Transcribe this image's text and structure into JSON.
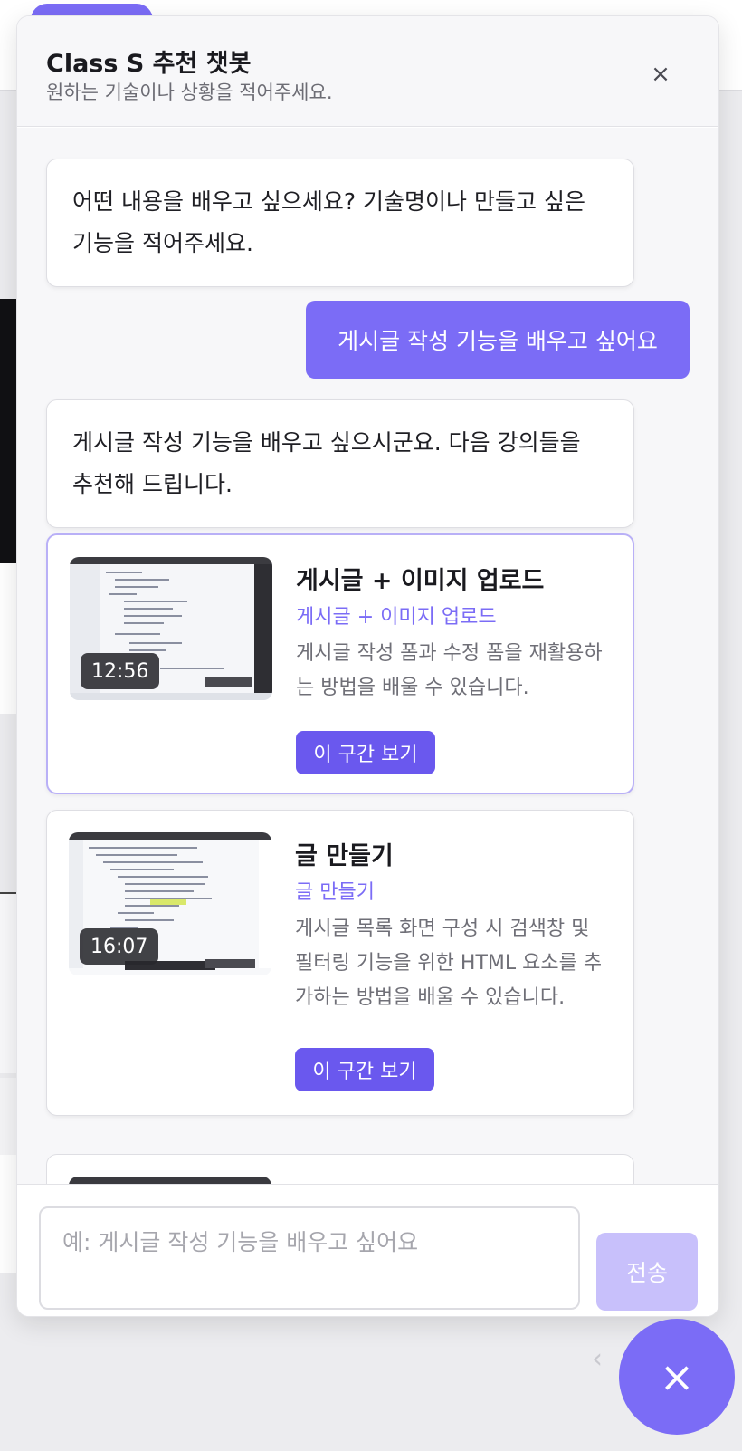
{
  "header": {
    "title": "Class S 추천 챗봇",
    "subtitle": "원하는 기술이나 상황을 적어주세요.",
    "close_icon": "×"
  },
  "messages": {
    "greeting": "어떤 내용을 배우고 싶으세요? 기술명이나 만들고 싶은 기능을 적어주세요.",
    "user_query": "게시글 작성 기능을 배우고 싶어요",
    "reply": "게시글 작성 기능을 배우고 싶으시군요. 다음 강의들을 추천해 드립니다."
  },
  "recommendations": [
    {
      "title": "게시글 + 이미지 업로드",
      "subtitle": "게시글 + 이미지 업로드",
      "description": "게시글 작성 폼과 수정 폼을 재활용하는 방법을 배울 수 있습니다.",
      "duration": "12:56",
      "button_label": "이 구간 보기"
    },
    {
      "title": "글 만들기",
      "subtitle": "글 만들기",
      "description": "게시글 목록 화면 구성 시 검색창 및 필터링 기능을 위한 HTML 요소를 추가하는 방법을 배울 수 있습니다.",
      "duration": "16:07",
      "button_label": "이 구간 보기"
    }
  ],
  "composer": {
    "placeholder": "예: 게시글 작성 기능을 배우고 싶어요",
    "send_label": "전송"
  },
  "fab": {
    "icon": "×"
  },
  "colors": {
    "accent": "#7b6cf6",
    "button": "#6a58ee",
    "send_disabled": "#c8c0fb"
  }
}
